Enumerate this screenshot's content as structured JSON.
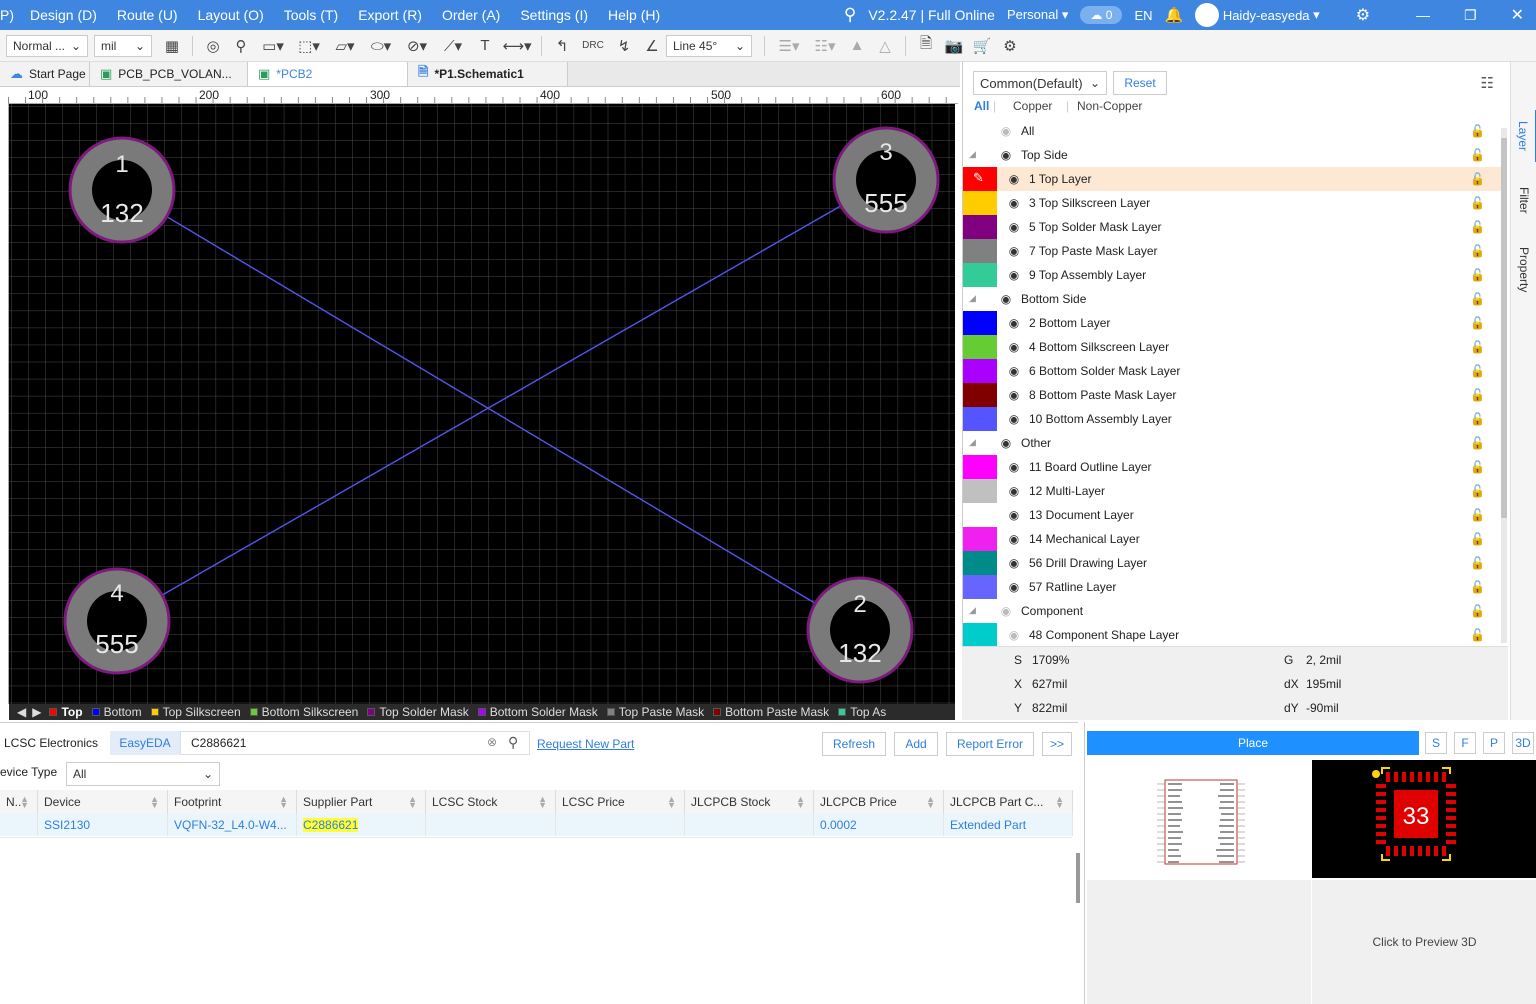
{
  "menu": [
    "P)",
    "Design (D)",
    "Route (U)",
    "Layout (O)",
    "Tools (T)",
    "Export (R)",
    "Order (A)",
    "Settings (I)",
    "Help (H)"
  ],
  "header": {
    "version": "V2.2.47 | Full Online",
    "team": "Personal",
    "cloud_count": "0",
    "lang": "EN",
    "user": "Haidy-easyeda"
  },
  "toolbar": {
    "mode": "Normal ...",
    "unit": "mil",
    "route_mode": "Line 45°",
    "drc": "DRC"
  },
  "tabs": [
    {
      "label": "Start Page",
      "icon": "cloud-icon"
    },
    {
      "label": "PCB_PCB_VOLAN...",
      "icon": "pcb-icon"
    },
    {
      "label": "*PCB2",
      "icon": "pcb-icon"
    },
    {
      "label": "*P1.Schematic1",
      "icon": "doc-icon"
    }
  ],
  "ruler": {
    "top": [
      "100",
      "200",
      "300",
      "400",
      "500",
      "600"
    ]
  },
  "pads": [
    {
      "num": "1",
      "net": "132"
    },
    {
      "num": "3",
      "net": "555"
    },
    {
      "num": "4",
      "net": "555"
    },
    {
      "num": "2",
      "net": "132"
    }
  ],
  "layerbar": [
    {
      "label": "Top",
      "color": "#ff0000"
    },
    {
      "label": "Bottom",
      "color": "#0000ff"
    },
    {
      "label": "Top Silkscreen",
      "color": "#ffcc00"
    },
    {
      "label": "Bottom Silkscreen",
      "color": "#66cc33"
    },
    {
      "label": "Top Solder Mask",
      "color": "#800080"
    },
    {
      "label": "Bottom Solder Mask",
      "color": "#aa00ff"
    },
    {
      "label": "Top Paste Mask",
      "color": "#808080"
    },
    {
      "label": "Bottom Paste Mask",
      "color": "#800000"
    },
    {
      "label": "Top As",
      "color": "#33cc99"
    }
  ],
  "layer_panel": {
    "preset": "Common(Default)",
    "reset": "Reset",
    "filters": [
      "All",
      "Copper",
      "Non-Copper"
    ],
    "rows": [
      {
        "type": "all",
        "label": "All"
      },
      {
        "type": "group",
        "label": "Top Side"
      },
      {
        "type": "layer",
        "label": "1 Top Layer",
        "color": "#ff0000",
        "selected": true
      },
      {
        "type": "layer",
        "label": "3 Top Silkscreen Layer",
        "color": "#ffcc00"
      },
      {
        "type": "layer",
        "label": "5 Top Solder Mask Layer",
        "color": "#800080"
      },
      {
        "type": "layer",
        "label": "7 Top Paste Mask Layer",
        "color": "#808080"
      },
      {
        "type": "layer",
        "label": "9 Top Assembly Layer",
        "color": "#33cc99"
      },
      {
        "type": "group",
        "label": "Bottom Side"
      },
      {
        "type": "layer",
        "label": "2 Bottom Layer",
        "color": "#0000ff"
      },
      {
        "type": "layer",
        "label": "4 Bottom Silkscreen Layer",
        "color": "#66cc33"
      },
      {
        "type": "layer",
        "label": "6 Bottom Solder Mask Layer",
        "color": "#aa00ff"
      },
      {
        "type": "layer",
        "label": "8 Bottom Paste Mask Layer",
        "color": "#800000"
      },
      {
        "type": "layer",
        "label": "10 Bottom Assembly Layer",
        "color": "#5555ff"
      },
      {
        "type": "group",
        "label": "Other"
      },
      {
        "type": "layer",
        "label": "11 Board Outline Layer",
        "color": "#ff00ff"
      },
      {
        "type": "layer",
        "label": "12 Multi-Layer",
        "color": "#c0c0c0"
      },
      {
        "type": "layer",
        "label": "13 Document Layer",
        "color": "#ffffff"
      },
      {
        "type": "layer",
        "label": "14 Mechanical Layer",
        "color": "#f020f0"
      },
      {
        "type": "layer",
        "label": "56 Drill Drawing Layer",
        "color": "#008b8b"
      },
      {
        "type": "layer",
        "label": "57 Ratline Layer",
        "color": "#6666ff",
        "lock_blue": true
      },
      {
        "type": "group",
        "label": "Component"
      },
      {
        "type": "layer",
        "label": "48 Component Shape Layer",
        "color": "#00cccc"
      }
    ]
  },
  "side_tabs": [
    "Layer",
    "Filter",
    "Property"
  ],
  "status": {
    "s_label": "S",
    "s": "1709%",
    "g_label": "G",
    "g": "2, 2mil",
    "x_label": "X",
    "x": "627mil",
    "dx_label": "dX",
    "dx": "195mil",
    "y_label": "Y",
    "y": "822mil",
    "dy_label": "dY",
    "dy": "-90mil"
  },
  "library": {
    "tabs": [
      "LCSC Electronics",
      "EasyEDA"
    ],
    "search": "C2886621",
    "request": "Request New Part",
    "buttons": [
      "Refresh",
      "Add",
      "Report Error",
      ">>"
    ],
    "device_type_label": "evice Type",
    "device_type": "All",
    "columns": [
      "N..",
      "Device",
      "Footprint",
      "Supplier Part",
      "LCSC Stock",
      "LCSC Price",
      "JLCPCB Stock",
      "JLCPCB Price",
      "JLCPCB Part C..."
    ],
    "row": [
      "",
      "SSI2130",
      "VQFN-32_L4.0-W4...",
      "C2886621",
      "",
      "",
      "",
      "0.0002",
      "Extended Part"
    ]
  },
  "preview": {
    "place": "Place",
    "views": [
      "S",
      "F",
      "P",
      "3D"
    ],
    "footprint_num": "33",
    "preview3d": "Click to Preview 3D"
  }
}
